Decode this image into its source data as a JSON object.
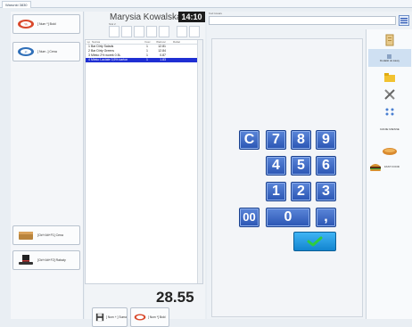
{
  "window": {
    "tab_label": "Warunki 3830"
  },
  "left_panel": {
    "top_buttons": [
      {
        "label": "[ Num *] Bold",
        "icon": "discount-icon"
      },
      {
        "label": "[ Num -] Cena",
        "icon": "price-tag-icon"
      }
    ],
    "bottom_buttons": [
      {
        "label": "[Ctrl+Alt+F1] Cena",
        "icon": "wallet-icon"
      },
      {
        "label": "[Ctrl+Alt+F2] Rabaty",
        "icon": "top-hat-icon"
      }
    ]
  },
  "receipt": {
    "customer_name": "Marysia Kowalska",
    "time": "14:10",
    "small_label": "Stol 2",
    "columns": [
      "Lp",
      "Nazwa",
      "Ilosc",
      "Wartosc",
      "Rabat"
    ],
    "items": [
      {
        "no": "1",
        "name": "Bar Dirty Salads",
        "qty": "1",
        "value": "12.81"
      },
      {
        "no": "2",
        "name": "Bar Dirty Greens",
        "qty": "1",
        "value": "12.84"
      },
      {
        "no": "3",
        "name": "Mleko 2% worek 0.5L",
        "qty": "1",
        "value": "0.87"
      },
      {
        "no": "4",
        "name": "Mleko Laciate 0,5% karton",
        "qty": "1",
        "value": "1.83"
      }
    ],
    "selected_index": 3,
    "total": "28.55"
  },
  "bottom_actions": [
    {
      "label": "[ Num + ] Suma",
      "icon": "floppy-icon"
    },
    {
      "label": "[ Num *] Bold",
      "icon": "discount-icon"
    }
  ],
  "search": {
    "label": "Kod towaru",
    "value": ""
  },
  "keypad": {
    "keys": [
      "C",
      "7",
      "8",
      "9",
      "4",
      "5",
      "6",
      "1",
      "2",
      "3",
      "00",
      "0",
      ","
    ],
    "ok_label": "OK"
  },
  "sidebar": [
    {
      "label": "",
      "icon": "document-icon"
    },
    {
      "label": "Dodatki do kawy",
      "icon": "cup-icon",
      "highlighted": true
    },
    {
      "label": "",
      "icon": "folder-icon"
    },
    {
      "label": "",
      "icon": "tools-icon"
    },
    {
      "label": "",
      "icon": "scale-icon"
    },
    {
      "label": "DANIE MIESNE",
      "icon": ""
    },
    {
      "label": "",
      "icon": "bread-icon"
    },
    {
      "label": "FAST FOOD",
      "icon": "burger-icon"
    }
  ],
  "colors": {
    "key_blue": "#2a55b3",
    "selected_row": "#1f2fd3",
    "ok_button": "#1285cf"
  }
}
